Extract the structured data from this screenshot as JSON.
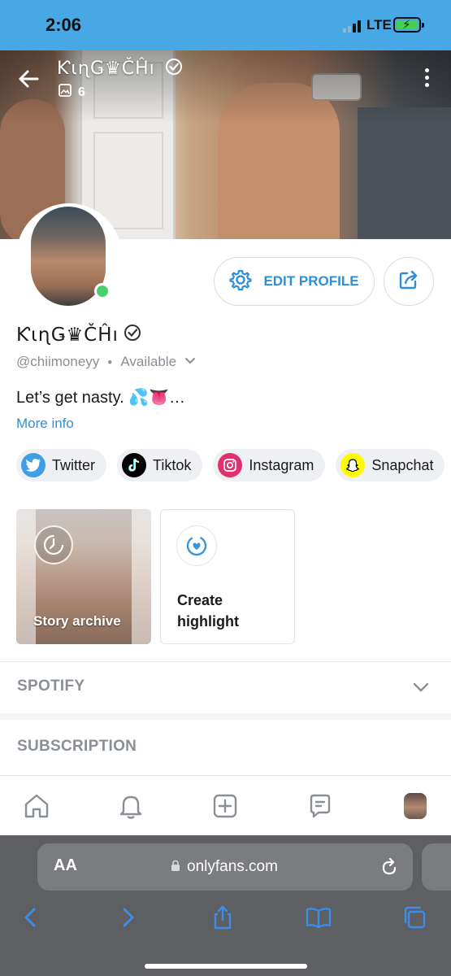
{
  "status_bar": {
    "time": "2:06",
    "network": "LTE"
  },
  "profile": {
    "display_name": "ƘιɳǤ♛ČĤı",
    "image_count": "6",
    "handle": "@chiimoneyy",
    "availability": "Available",
    "bio": "Let’s get nasty. 💦👅…",
    "more_info": "More info"
  },
  "actions": {
    "edit_profile": "EDIT PROFILE"
  },
  "socials": [
    {
      "label": "Twitter",
      "color": "#1d9bf0"
    },
    {
      "label": "Tiktok",
      "color": "#000000"
    },
    {
      "label": "Instagram",
      "color": "#e1306c"
    },
    {
      "label": "Snapchat",
      "color": "#fffc00"
    }
  ],
  "highlights": {
    "story_archive": "Story archive",
    "create_highlight": "Create highlight"
  },
  "sections": {
    "spotify": "SPOTIFY",
    "subscription": "SUBSCRIPTION"
  },
  "bottom_nav": [
    "home-icon",
    "bell-icon",
    "plus-square-icon",
    "chat-icon",
    "avatar"
  ],
  "browser": {
    "text_size": "AA",
    "domain": "onlyfans.com"
  },
  "colors": {
    "accent": "#2d8fd8",
    "status_bar": "#48a8e6",
    "online": "#4ad06a"
  }
}
